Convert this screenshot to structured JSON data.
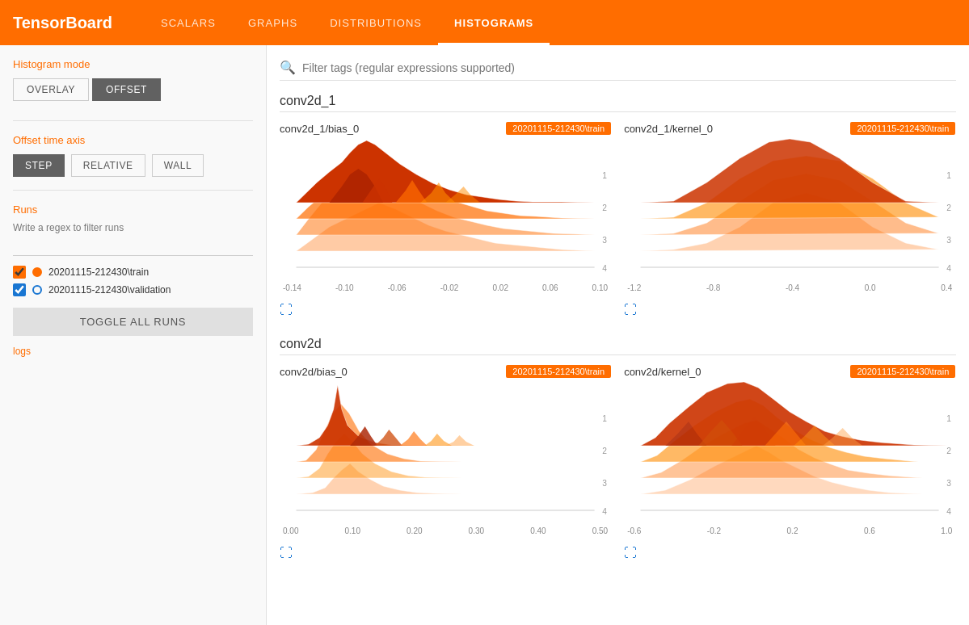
{
  "header": {
    "logo": "TensorBoard",
    "nav": [
      {
        "label": "SCALARS",
        "active": false
      },
      {
        "label": "GRAPHS",
        "active": false
      },
      {
        "label": "DISTRIBUTIONS",
        "active": false
      },
      {
        "label": "HISTOGRAMS",
        "active": true
      }
    ]
  },
  "sidebar": {
    "histogram_mode_label": "Histogram mode",
    "mode_buttons": [
      {
        "label": "OVERLAY",
        "active": false
      },
      {
        "label": "OFFSET",
        "active": true
      }
    ],
    "offset_time_axis_label": "Offset time axis",
    "time_buttons": [
      {
        "label": "STEP",
        "active": true
      },
      {
        "label": "RELATIVE",
        "active": false
      },
      {
        "label": "WALL",
        "active": false
      }
    ],
    "runs_label": "Runs",
    "filter_label": "Write a regex to filter runs",
    "runs": [
      {
        "label": "20201115-212430\\train",
        "checked": true,
        "color": "orange"
      },
      {
        "label": "20201115-212430\\validation",
        "checked": true,
        "color": "blue"
      }
    ],
    "toggle_all_label": "TOGGLE ALL RUNS",
    "logs_label": "logs"
  },
  "search": {
    "placeholder": "Filter tags (regular expressions supported)"
  },
  "sections": [
    {
      "title": "conv2d_1",
      "charts": [
        {
          "title": "conv2d_1/bias_0",
          "badge": "20201115-212430\\train",
          "x_labels": [
            "-0.14",
            "-0.10",
            "-0.06",
            "-0.02",
            "0.02",
            "0.06",
            "0.10"
          ],
          "y_labels": [
            "1",
            "2",
            "3",
            "4"
          ],
          "type": "bias"
        },
        {
          "title": "conv2d_1/kernel_0",
          "badge": "20201115-212430\\train",
          "x_labels": [
            "-1.2",
            "-0.8",
            "-0.4",
            "0.0",
            "0.4"
          ],
          "y_labels": [
            "1",
            "2",
            "3",
            "4"
          ],
          "type": "kernel"
        }
      ]
    },
    {
      "title": "conv2d",
      "charts": [
        {
          "title": "conv2d/bias_0",
          "badge": "20201115-212430\\train",
          "x_labels": [
            "0.00",
            "0.10",
            "0.20",
            "0.30",
            "0.40",
            "0.50"
          ],
          "y_labels": [
            "1",
            "2",
            "3",
            "4"
          ],
          "type": "conv2d_bias"
        },
        {
          "title": "conv2d/kernel_0",
          "badge": "20201115-212430\\train",
          "x_labels": [
            "-0.6",
            "-0.2",
            "0.2",
            "0.6",
            "1.0"
          ],
          "y_labels": [
            "1",
            "2",
            "3",
            "4"
          ],
          "type": "conv2d_kernel"
        }
      ]
    }
  ],
  "colors": {
    "orange": "#FF6D00",
    "accent": "#1976d2"
  }
}
